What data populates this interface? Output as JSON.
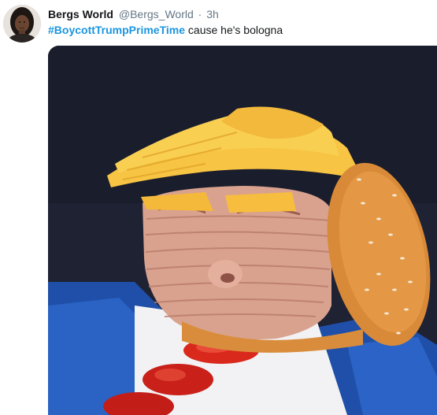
{
  "tweet": {
    "author_name": "Bergs World",
    "handle": "@Bergs_World",
    "separator": "·",
    "time": "3h",
    "hashtag": "#BoycottTrumpPrimeTime",
    "text": " cause he's bologna"
  },
  "icons": {
    "avatar": "user-avatar-photo",
    "media": "tweet-photo"
  },
  "colors": {
    "hashtag": "#1b95e0",
    "name": "#14171a",
    "secondary": "#657786"
  }
}
